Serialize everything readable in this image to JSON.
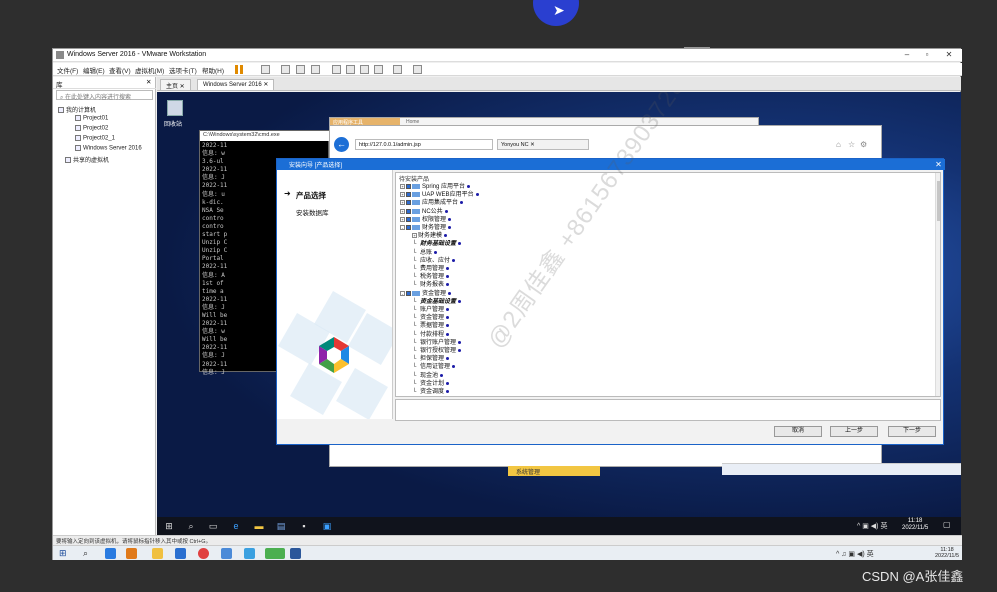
{
  "host": {
    "window_title": "Windows Server 2016 - VMware Workstation",
    "menu": [
      "文件(F)",
      "编辑(E)",
      "查看(V)",
      "虚拟机(M)",
      "选项卡(T)",
      "帮助(H)"
    ],
    "library": {
      "header": "库",
      "search_placeholder": "在此处键入内容进行搜索",
      "tree": [
        "我的计算机",
        "Project01",
        "Project02",
        "Project02_1",
        "Windows Server 2016",
        "共享的虚拟机"
      ]
    },
    "tabs": [
      "主页",
      "Windows Server 2016"
    ],
    "status_bar": "要将输入定向到该虚拟机，请将鼠标指针移入其中或按 Ctrl+G。",
    "clock": {
      "time": "11:18",
      "date": "2022/11/5"
    }
  },
  "guest": {
    "recycle_bin": "回收站",
    "cmd": {
      "title": "C:\\Windows\\system32\\cmd.exe",
      "lines": [
        "2022-11",
        "信息: w",
        "3.6-ul",
        "2022-11",
        "信息: J",
        "2022-11",
        "信息: u",
        "k-dic.",
        "NSA Se",
        "contro",
        "contro",
        "start p",
        "Unzip C",
        "Unzip C",
        "Portal",
        "2022-11",
        "信息: A",
        "1st of",
        "time a",
        "2022-11",
        "信息: J",
        "Will be",
        "2022-11",
        "信息: w",
        "Will be",
        "2022-11",
        "信息: J",
        "2022-11",
        "信息: J"
      ]
    },
    "browser_back": {
      "tab": "应用程序工具",
      "title": "Home"
    },
    "browser": {
      "url": "http://127.0.0.1/admin.jsp",
      "tab": "Yonyou NC",
      "system_item": "系统管理"
    },
    "installer": {
      "title": "安装向导   [产品选择]",
      "steps": [
        "产品选择",
        "安装数据库"
      ],
      "tree_header": "待安装产品",
      "nodes": [
        {
          "label": "Spring 应用平台",
          "level": 0,
          "exp": "+",
          "cb": true,
          "folder": true
        },
        {
          "label": "UAP WEB应用平台",
          "level": 0,
          "exp": "+",
          "cb": true,
          "folder": true
        },
        {
          "label": "应用集成平台",
          "level": 0,
          "exp": "+",
          "cb": true,
          "folder": true
        },
        {
          "label": "NC公共",
          "level": 0,
          "exp": "+",
          "cb": true,
          "folder": true
        },
        {
          "label": "权限管理",
          "level": 0,
          "exp": "+",
          "cb": true,
          "folder": true
        },
        {
          "label": "财务管理",
          "level": 0,
          "exp": "-",
          "cb": true,
          "folder": true
        },
        {
          "label": "财务建模",
          "level": 1,
          "exp": "+",
          "cb": false,
          "folder": false
        },
        {
          "label": "财务基础设置",
          "level": 1,
          "exp": "",
          "cb": false,
          "folder": false,
          "style": "it"
        },
        {
          "label": "总账",
          "level": 1,
          "exp": "",
          "cb": false,
          "folder": false
        },
        {
          "label": "应收、应付",
          "level": 1,
          "exp": "",
          "cb": false,
          "folder": false
        },
        {
          "label": "费用管理",
          "level": 1,
          "exp": "",
          "cb": false,
          "folder": false
        },
        {
          "label": "税务管理",
          "level": 1,
          "exp": "",
          "cb": false,
          "folder": false
        },
        {
          "label": "财务报表",
          "level": 1,
          "exp": "",
          "cb": false,
          "folder": false
        },
        {
          "label": "资金管理",
          "level": 0,
          "exp": "-",
          "cb": true,
          "folder": true
        },
        {
          "label": "资金基础设置",
          "level": 1,
          "exp": "",
          "cb": false,
          "folder": false,
          "style": "it"
        },
        {
          "label": "账户管理",
          "level": 1,
          "exp": "",
          "cb": false,
          "folder": false
        },
        {
          "label": "资金管理",
          "level": 1,
          "exp": "",
          "cb": false,
          "folder": false
        },
        {
          "label": "票据管理",
          "level": 1,
          "exp": "",
          "cb": false,
          "folder": false
        },
        {
          "label": "付款排程",
          "level": 1,
          "exp": "",
          "cb": false,
          "folder": false
        },
        {
          "label": "银行账户管理",
          "level": 1,
          "exp": "",
          "cb": false,
          "folder": false
        },
        {
          "label": "银行授权管理",
          "level": 1,
          "exp": "",
          "cb": false,
          "folder": false
        },
        {
          "label": "担保管理",
          "level": 1,
          "exp": "",
          "cb": false,
          "folder": false
        },
        {
          "label": "信用证管理",
          "level": 1,
          "exp": "",
          "cb": false,
          "folder": false
        },
        {
          "label": "现金池",
          "level": 1,
          "exp": "",
          "cb": false,
          "folder": false
        },
        {
          "label": "资金计划",
          "level": 1,
          "exp": "",
          "cb": false,
          "folder": false
        },
        {
          "label": "资金调度",
          "level": 1,
          "exp": "",
          "cb": false,
          "folder": false
        }
      ],
      "buttons": {
        "cancel": "取消",
        "prev": "上一步",
        "next": "下一步"
      },
      "watermark": "@2周佳鑫 +8615673903728"
    },
    "clock": {
      "time": "11:18",
      "date": "2022/11/5"
    }
  },
  "overlay": {
    "watermark": "CSDN @A张佳鑫"
  },
  "colors": {
    "accent": "#1b6ed6",
    "pointer": "#2a3fd0",
    "system_item": "#f2c642"
  }
}
